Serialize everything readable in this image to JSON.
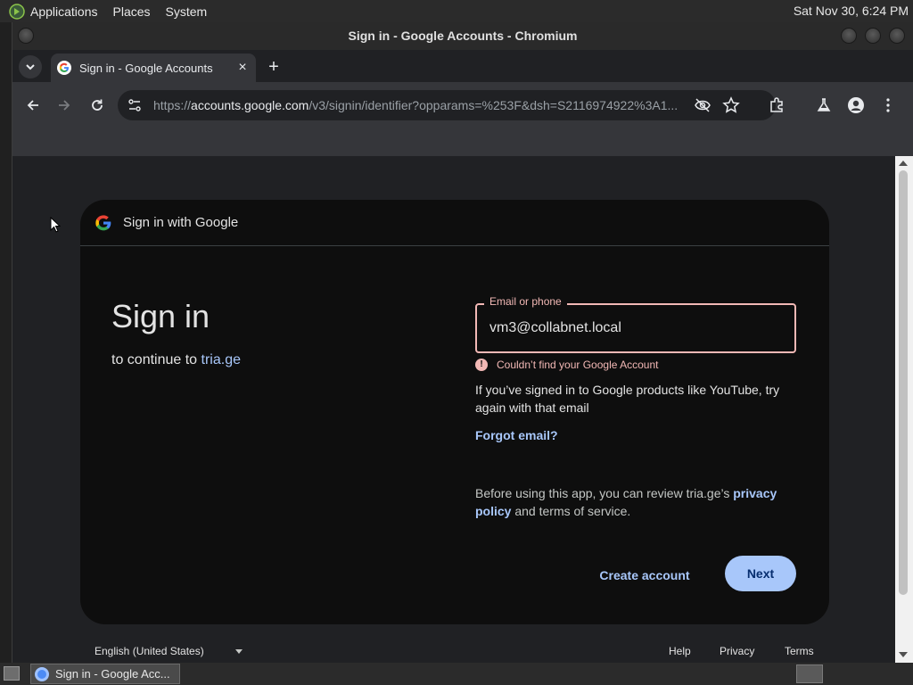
{
  "desktop_panel": {
    "menus": [
      "Applications",
      "Places",
      "System"
    ],
    "clock": "Sat Nov 30,  6:24 PM"
  },
  "window": {
    "title": "Sign in - Google Accounts - Chromium"
  },
  "tab": {
    "title": "Sign in - Google Accounts",
    "close": "×",
    "new_tab": "+"
  },
  "omnibox": {
    "url_scheme": "https://",
    "url_host": "accounts.google.com",
    "url_path": "/v3/signin/identifier?opparams=%253F&dsh=S2116974922%3A1..."
  },
  "card": {
    "header_label": "Sign in with Google",
    "title": "Sign in",
    "continue_prefix": "to continue to ",
    "continue_link": "tria.ge",
    "email_label": "Email or phone",
    "email_value": "vm3@collabnet.local",
    "error_text": "Couldn’t find your Google Account",
    "hint_text": "If you’ve signed in to Google products like YouTube, try again with that email",
    "forgot_email": "Forgot email?",
    "privacy_prefix": "Before using this app, you can review tria.ge’s ",
    "privacy_link": "privacy policy",
    "privacy_suffix": " and terms of service.",
    "create_account": "Create account",
    "next": "Next"
  },
  "footer": {
    "language": "English (United States)",
    "help": "Help",
    "privacy": "Privacy",
    "terms": "Terms"
  },
  "taskbar": {
    "item_label": "Sign in - Google Acc..."
  },
  "colors": {
    "accent": "#a8c7fa",
    "error": "#f2b8b5",
    "card_bg": "#0e0e0e"
  }
}
